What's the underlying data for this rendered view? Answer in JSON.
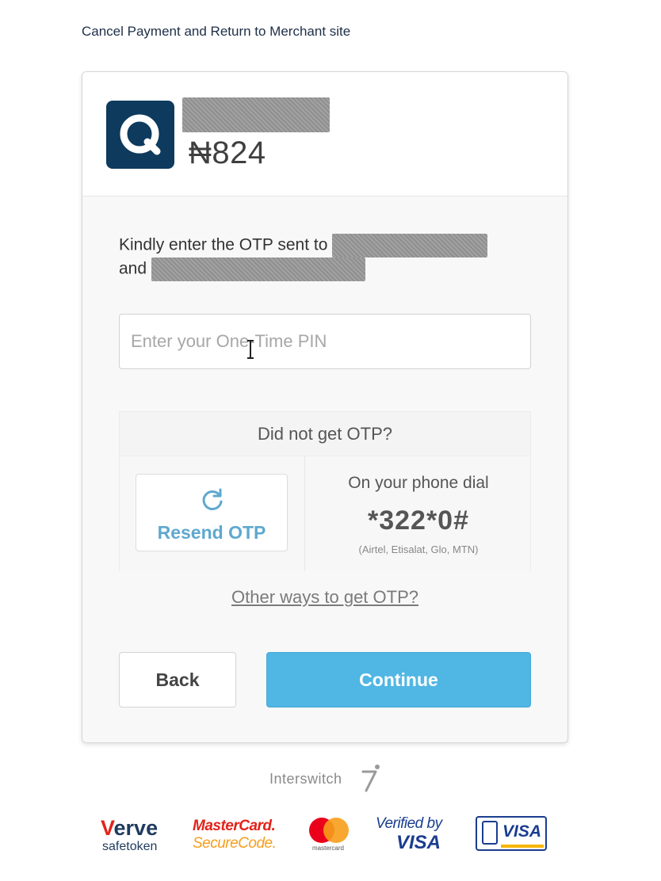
{
  "header": {
    "cancel_link": "Cancel Payment and Return to Merchant site"
  },
  "merchant": {
    "logo_icon": "q-logo-icon",
    "amount": "₦824"
  },
  "otp": {
    "instruction_prefix": "Kindly enter the OTP sent to",
    "instruction_and": "and",
    "placeholder": "Enter your One-Time PIN",
    "not_received_title": "Did not get OTP?",
    "resend_label": "Resend OTP",
    "resend_icon": "refresh-icon",
    "dial_label": "On your phone dial",
    "dial_code": "*322*0#",
    "dial_networks": "(Airtel, Etisalat, Glo, MTN)",
    "other_ways": "Other ways to get OTP?"
  },
  "actions": {
    "back_label": "Back",
    "continue_label": "Continue"
  },
  "footer": {
    "brand": "Interswitch",
    "badges": {
      "verve_word": "erve",
      "verve_letter": "V",
      "verve_sub": "safetoken",
      "mastercard_line1": "MasterCard.",
      "mastercard_line2": "SecureCode.",
      "mastercard_small": "mastercard",
      "vbv_line1": "Verified by",
      "vbv_line2": "VISA",
      "visa_word": "VISA"
    }
  },
  "colors": {
    "primary_button": "#50b6e4",
    "link_accent": "#5fa8cf",
    "merchant_logo_bg": "#0d3a5d"
  }
}
